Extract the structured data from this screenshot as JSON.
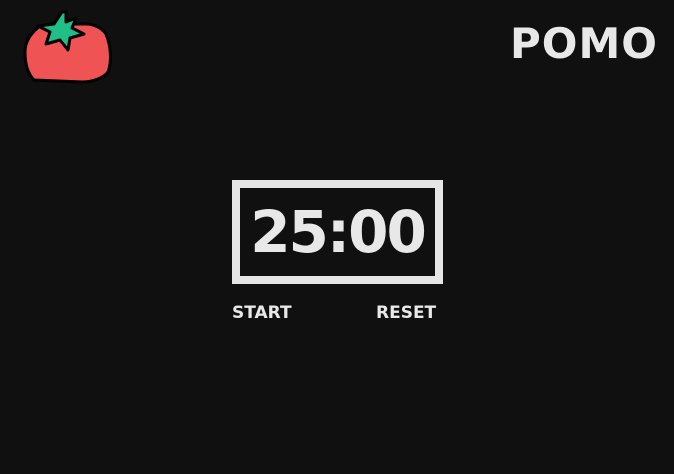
{
  "header": {
    "logo_icon": "tomato-icon",
    "title": "POMO"
  },
  "timer": {
    "display": "25:00"
  },
  "controls": {
    "start_label": "START",
    "reset_label": "RESET"
  },
  "colors": {
    "background": "#101010",
    "foreground": "#e8e8e8",
    "tomato_red": "#f05353",
    "leaf_green": "#1fbf87"
  }
}
